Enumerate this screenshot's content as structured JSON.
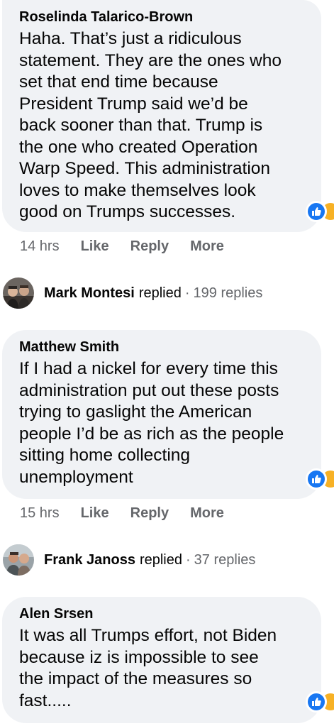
{
  "comments": [
    {
      "author": "Roselinda Talarico-Brown",
      "text": "Haha. That’s just a ridiculous\nstatement. They are the ones who\nset that end time because\nPresident Trump said we’d be\nback sooner than that. Trump is\nthe one who created Operation\nWarp Speed. This administration\nloves to make themselves look\ngood on Trumps successes.",
      "time": "14 hrs",
      "like_label": "Like",
      "reply_label": "Reply",
      "more_label": "More",
      "reactions": [
        "like-icon",
        "haha-icon"
      ]
    },
    {
      "author": "Matthew Smith",
      "text": "If I had a nickel for every time this\nadministration put out these posts\ntrying to gaslight the American\npeople I’d be as rich as the people\nsitting home collecting\nunemployment",
      "time": "15 hrs",
      "like_label": "Like",
      "reply_label": "Reply",
      "more_label": "More",
      "reactions": [
        "like-icon",
        "haha-icon"
      ]
    },
    {
      "author": "Alen Srsen",
      "text": "It was all Trumps effort, not Biden\nbecause iz is impossible to see\nthe impact of the measures so\nfast.....",
      "reactions": [
        "like-icon",
        "haha-icon"
      ]
    }
  ],
  "replies_summary": [
    {
      "name": "Mark Montesi",
      "verb": "replied",
      "separator": "·",
      "count": "199 replies"
    },
    {
      "name": "Frank Janoss",
      "verb": "replied",
      "separator": "·",
      "count": "37 replies"
    }
  ],
  "colors": {
    "bubble": "#f0f2f5",
    "text": "#050505",
    "secondary": "#65676b",
    "like_blue": "#1877f2",
    "haha_yellow": "#f7b125"
  }
}
